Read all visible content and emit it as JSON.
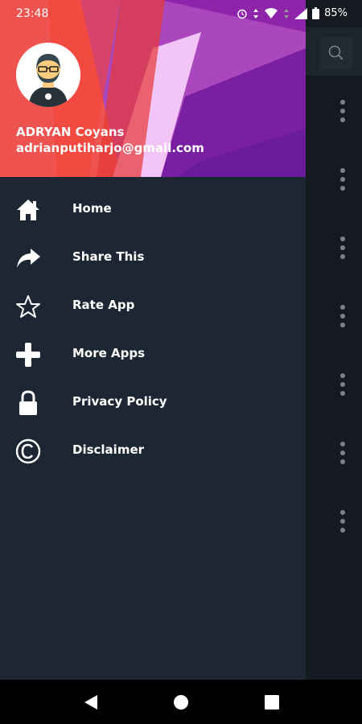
{
  "status_bar": {
    "time": "23:48",
    "battery": "85%",
    "icons": [
      "alarm-icon",
      "data-arrows-icon",
      "wifi-icon",
      "signal-icon",
      "battery-icon"
    ]
  },
  "drawer": {
    "user": {
      "name": "ADRYAN Coyans",
      "email": "adrianputiharjo@gmail.com"
    },
    "menu": [
      {
        "label": "Home",
        "icon": "home-icon"
      },
      {
        "label": "Share This",
        "icon": "share-icon"
      },
      {
        "label": "Rate App",
        "icon": "star-icon"
      },
      {
        "label": "More Apps",
        "icon": "plus-icon"
      },
      {
        "label": "Privacy Policy",
        "icon": "lock-icon"
      },
      {
        "label": "Disclaimer",
        "icon": "copyright-icon"
      }
    ]
  },
  "app_background": {
    "icons": [
      "search-icon",
      "more-vert-icon"
    ]
  },
  "nav_bar": {
    "icons": [
      "back-icon",
      "home-circle-icon",
      "recents-icon"
    ]
  },
  "colors": {
    "drawer_bg": "#1d2733",
    "header_red": "#ef5350",
    "header_purple": "#9c27b0",
    "text": "#ffffff"
  }
}
